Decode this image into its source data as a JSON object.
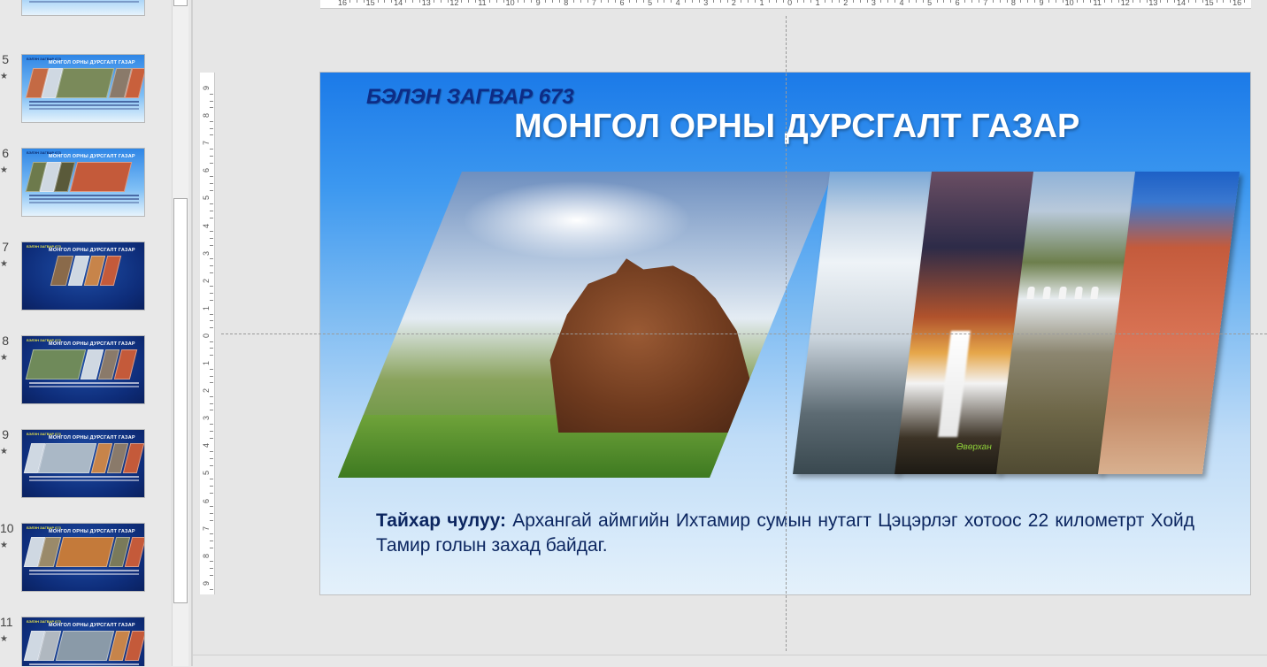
{
  "thumbnails": [
    {
      "num": "",
      "star": "",
      "variant": "light",
      "subtitle": "",
      "title": "",
      "caption": ""
    },
    {
      "num": "5",
      "star": "★",
      "variant": "light",
      "subtitle": "БЭЛЭН ЗАГВАР 673",
      "title": "МОНГОЛ ОРНЫ ДУРСГАЛТ ГАЗАР"
    },
    {
      "num": "6",
      "star": "★",
      "variant": "light",
      "subtitle": "БЭЛЭН ЗАГВАР 673",
      "title": "МОНГОЛ ОРНЫ ДУРСГАЛТ ГАЗАР"
    },
    {
      "num": "7",
      "star": "★",
      "variant": "dark",
      "subtitle": "БЭЛЭН ЗАГВАР 673",
      "title": "МОНГОЛ ОРНЫ ДУРСГАЛТ ГАЗАР"
    },
    {
      "num": "8",
      "star": "★",
      "variant": "dark",
      "subtitle": "БЭЛЭН ЗАГВАР 673",
      "title": "МОНГОЛ ОРНЫ ДУРСГАЛТ ГАЗАР"
    },
    {
      "num": "9",
      "star": "★",
      "variant": "dark",
      "subtitle": "БЭЛЭН ЗАГВАР 673",
      "title": "МОНГОЛ ОРНЫ ДУРСГАЛТ ГАЗАР"
    },
    {
      "num": "10",
      "star": "★",
      "variant": "dark",
      "subtitle": "БЭЛЭН ЗАГВАР 673",
      "title": "МОНГОЛ ОРНЫ ДУРСГАЛТ ГАЗАР"
    },
    {
      "num": "11",
      "star": "★",
      "variant": "dark",
      "subtitle": "БЭЛЭН ЗАГВАР 673",
      "title": "МОНГОЛ ОРНЫ ДУРСГАЛТ ГАЗАР"
    }
  ],
  "ruler": {
    "horizontal_labels": [
      "16",
      "15",
      "14",
      "13",
      "12",
      "11",
      "10",
      "9",
      "8",
      "7",
      "6",
      "5",
      "4",
      "3",
      "2",
      "1",
      "0",
      "1",
      "2",
      "3",
      "4",
      "5",
      "6",
      "7",
      "8",
      "9",
      "10",
      "11",
      "12",
      "13",
      "14",
      "15",
      "16"
    ],
    "vertical_labels": [
      "9",
      "8",
      "7",
      "6",
      "5",
      "4",
      "3",
      "2",
      "1",
      "0",
      "1",
      "2",
      "3",
      "4",
      "5",
      "6",
      "7",
      "8",
      "9"
    ]
  },
  "slide": {
    "subtitle": "БЭЛЭН ЗАГВАР 673",
    "title": "МОНГОЛ ОРНЫ ДУРСГАЛТ ГАЗАР",
    "caption_bold": "Тайхар чулуу:",
    "caption_text": " Архангай аймгийн Ихтамир сумын нутагт Цэцэрлэг хотоос 22 километрт Хойд Тамир голын захад байдаг.",
    "photo_caption": "Өвөрхан"
  },
  "colors": {
    "slide_top": "#1b7ae8",
    "slide_bottom": "#e4f1fb",
    "subtitle": "#0d2c86",
    "body_text": "#0c2660"
  }
}
